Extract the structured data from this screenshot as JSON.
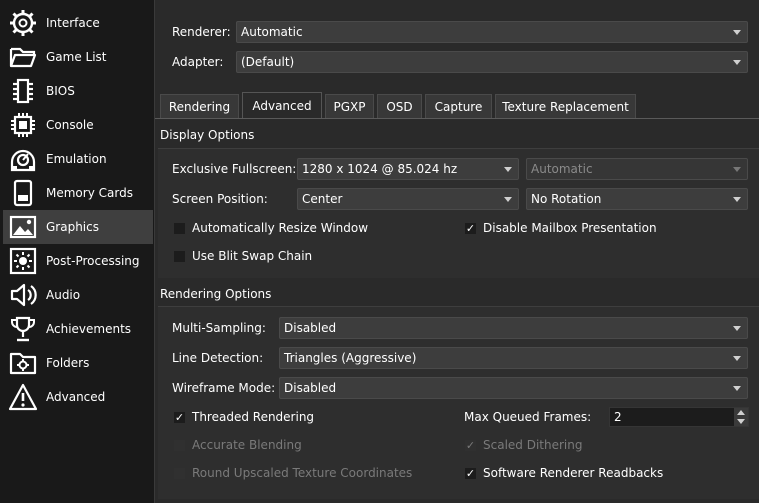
{
  "sidebar": {
    "items": [
      {
        "label": "Interface",
        "icon": "gear-icon"
      },
      {
        "label": "Game List",
        "icon": "folder-open-icon"
      },
      {
        "label": "BIOS",
        "icon": "chip-icon"
      },
      {
        "label": "Console",
        "icon": "cpu-icon"
      },
      {
        "label": "Emulation",
        "icon": "emulation-icon"
      },
      {
        "label": "Memory Cards",
        "icon": "memory-card-icon"
      },
      {
        "label": "Graphics",
        "icon": "image-icon"
      },
      {
        "label": "Post-Processing",
        "icon": "sun-icon"
      },
      {
        "label": "Audio",
        "icon": "speaker-icon"
      },
      {
        "label": "Achievements",
        "icon": "trophy-icon"
      },
      {
        "label": "Folders",
        "icon": "folder-settings-icon"
      },
      {
        "label": "Advanced",
        "icon": "warning-icon"
      }
    ],
    "selected": "Graphics"
  },
  "top": {
    "renderer_label": "Renderer:",
    "renderer_value": "Automatic",
    "adapter_label": "Adapter:",
    "adapter_value": "(Default)"
  },
  "tabs": [
    "Rendering",
    "Advanced",
    "PGXP",
    "OSD",
    "Capture",
    "Texture Replacement"
  ],
  "active_tab": "Advanced",
  "display_options": {
    "header": "Display Options",
    "exclusive_fullscreen_label": "Exclusive Fullscreen:",
    "exclusive_fullscreen_value": "1280 x 1024 @ 85.024 hz",
    "exclusive_fullscreen_format": "Automatic",
    "screen_position_label": "Screen Position:",
    "screen_position_value": "Center",
    "rotation_value": "No Rotation",
    "auto_resize_label": "Automatically Resize Window",
    "disable_mailbox_label": "Disable Mailbox Presentation",
    "blit_swap_label": "Use Blit Swap Chain"
  },
  "rendering_options": {
    "header": "Rendering Options",
    "multisampling_label": "Multi-Sampling:",
    "multisampling_value": "Disabled",
    "line_detection_label": "Line Detection:",
    "line_detection_value": "Triangles (Aggressive)",
    "wireframe_label": "Wireframe Mode:",
    "wireframe_value": "Disabled",
    "threaded_label": "Threaded Rendering",
    "max_queued_label": "Max Queued Frames:",
    "max_queued_value": "2",
    "accurate_blending_label": "Accurate Blending",
    "scaled_dithering_label": "Scaled Dithering",
    "round_upscaled_label": "Round Upscaled Texture Coordinates",
    "software_readbacks_label": "Software Renderer Readbacks"
  },
  "check_glyph": "✓"
}
